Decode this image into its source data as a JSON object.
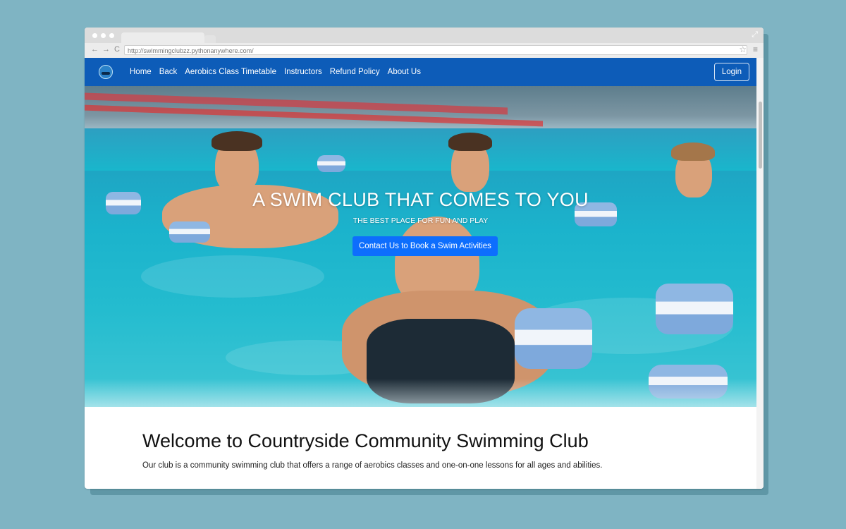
{
  "browser": {
    "url": "http://swimmingclubzz.pythonanywhere.com/",
    "back_glyph": "←",
    "forward_glyph": "→",
    "reload_glyph": "C",
    "star_glyph": "☆",
    "menu_glyph": "≡",
    "expand_glyph": "⤢"
  },
  "nav": {
    "logo_icon": "swimmer-logo-icon",
    "links": [
      {
        "label": "Home"
      },
      {
        "label": "Back"
      },
      {
        "label": "Aerobics Class Timetable"
      },
      {
        "label": "Instructors"
      },
      {
        "label": "Refund Policy"
      },
      {
        "label": "About Us"
      }
    ],
    "login_label": "Login"
  },
  "hero": {
    "title": "A SWIM CLUB THAT COMES TO YOU",
    "subtitle": "THE BEST PLACE FOR FUN AND PLAY",
    "cta_label": "Contact Us to Book a Swim Activities"
  },
  "welcome": {
    "heading": "Welcome to Countryside Community Swimming Club",
    "body": "Our club is a community swimming club that offers a range of aerobics classes and one-on-one lessons for all ages and abilities."
  },
  "colors": {
    "page_bg": "#7fb4c3",
    "nav_bg": "#0d5cb8",
    "cta_bg": "#0d6efd"
  }
}
